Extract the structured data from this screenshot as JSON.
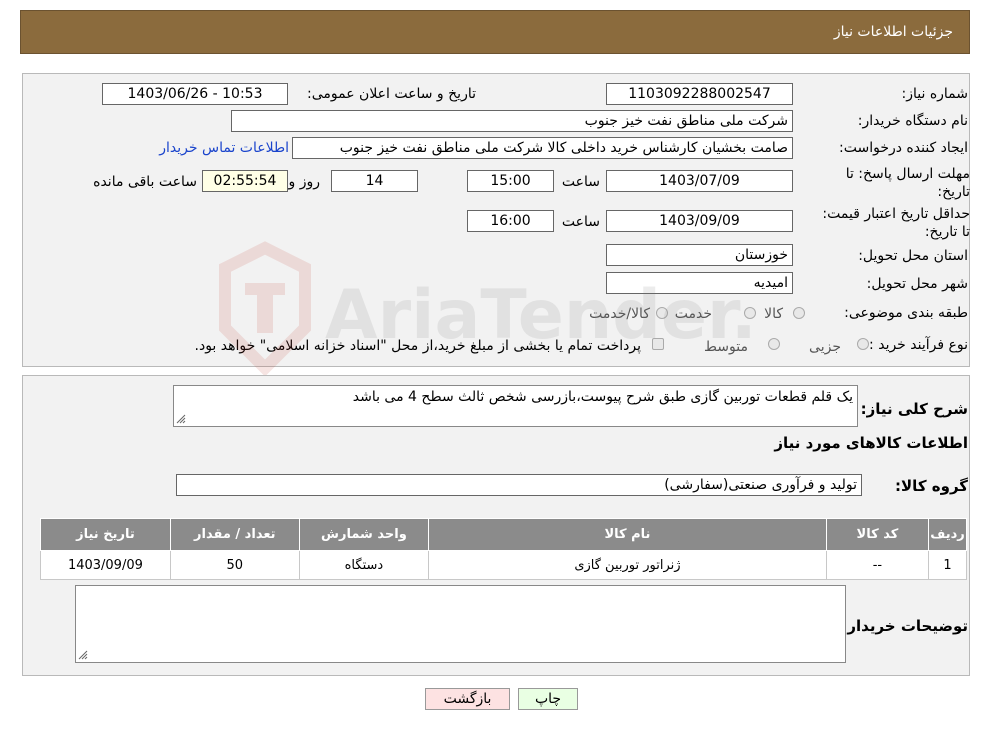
{
  "header": {
    "title": "جزئیات اطلاعات نیاز"
  },
  "form": {
    "need_number_label": "شماره نیاز:",
    "need_number": "1103092288002547",
    "announce_label": "تاریخ و ساعت اعلان عمومی:",
    "announce_value": "1403/06/26 - 10:53",
    "buyer_label": "نام دستگاه خریدار:",
    "buyer_value": "شرکت ملی مناطق نفت خیز جنوب",
    "creator_label": "ایجاد کننده درخواست:",
    "creator_value": "صامت  بخشیان  کارشناس خرید داخلی کالا  شرکت ملی مناطق نفت خیز جنوب",
    "contact_link": "اطلاعات تماس خریدار",
    "deadline_label": "مهلت ارسال پاسخ: تا تاریخ:",
    "deadline_date": "1403/07/09",
    "time_label": "ساعت",
    "deadline_time": "15:00",
    "days_value": "14",
    "days_label": "روز و",
    "remaining_value": "02:55:54",
    "remaining_label": "ساعت باقی مانده",
    "validity_label": "حداقل تاریخ اعتبار قیمت: تا تاریخ:",
    "validity_date": "1403/09/09",
    "validity_time": "16:00",
    "province_label": "استان محل تحویل:",
    "province_value": "خوزستان",
    "city_label": "شهر محل تحویل:",
    "city_value": "امیدیه",
    "category_label": "طبقه بندی موضوعی:",
    "category_options": [
      "کالا",
      "خدمت",
      "کالا/خدمت"
    ],
    "process_label": "نوع فرآیند خرید :",
    "process_options": [
      "جزیی",
      "متوسط"
    ],
    "process_note": "پرداخت تمام یا بخشی از مبلغ خرید،از محل \"اسناد خزانه اسلامی\" خواهد بود."
  },
  "details": {
    "description_label": "شرح کلی نیاز:",
    "description_value": "یک قلم قطعات توربین گازی طبق شرح پیوست،بازرسی شخص ثالث سطح 4 می باشد",
    "items_title": "اطلاعات کالاهای مورد نیاز",
    "group_label": "گروه کالا:",
    "group_value": "تولید و فرآوری صنعتی(سفارشی)",
    "table_headers": [
      "ردیف",
      "کد کالا",
      "نام کالا",
      "واحد شمارش",
      "تعداد / مقدار",
      "تاریخ نیاز"
    ],
    "table_rows": [
      [
        "1",
        "--",
        "ژنراتور توربین گازی",
        "دستگاه",
        "50",
        "1403/09/09"
      ]
    ],
    "buyer_notes_label": "توضیحات خریدار:"
  },
  "buttons": {
    "print": "چاپ",
    "back": "بازگشت"
  },
  "watermark": {
    "text": "AriaTender.neT"
  },
  "colors": {
    "header_bg": "#8b6b3d",
    "table_header_bg": "#8b8b8b",
    "link": "#1a44cc",
    "back_btn": "#fde2e2",
    "print_btn": "#e9ffe3"
  }
}
